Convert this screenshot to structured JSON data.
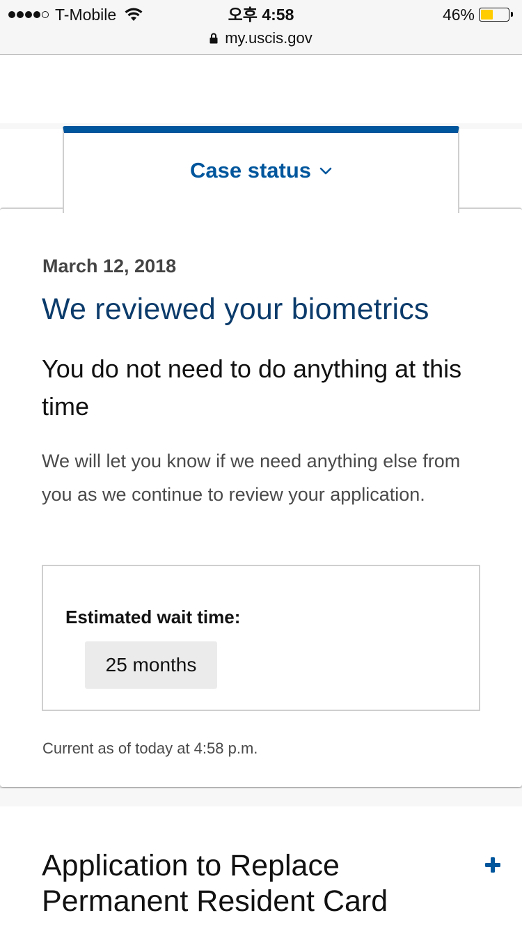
{
  "status_bar": {
    "carrier": "T-Mobile",
    "signal_bars_filled": 4,
    "signal_bars_total": 5,
    "time": "오후 4:58",
    "battery_percent_label": "46%",
    "battery_level": 0.46,
    "battery_color": "#ffcc00",
    "icons": [
      "signal-dots-icon",
      "wifi-icon",
      "battery-icon"
    ]
  },
  "browser": {
    "url": "my.uscis.gov",
    "secure_icon": "lock-icon"
  },
  "tab": {
    "label": "Case status",
    "icon": "chevron-down-icon",
    "accent_color": "#00569c"
  },
  "case_card": {
    "date": "March 12, 2018",
    "headline": "We reviewed your biometrics",
    "subhead": "You do not need to do anything at this time",
    "body": "We will let you know if we need anything else from you as we continue to review your application.",
    "wait_time": {
      "label": "Estimated wait time:",
      "value": "25 months"
    },
    "current_as_of": "Current as of today at 4:58 p.m."
  },
  "application_card": {
    "title": "Application to Replace Permanent Resident Card",
    "expand_icon": "plus-icon"
  }
}
